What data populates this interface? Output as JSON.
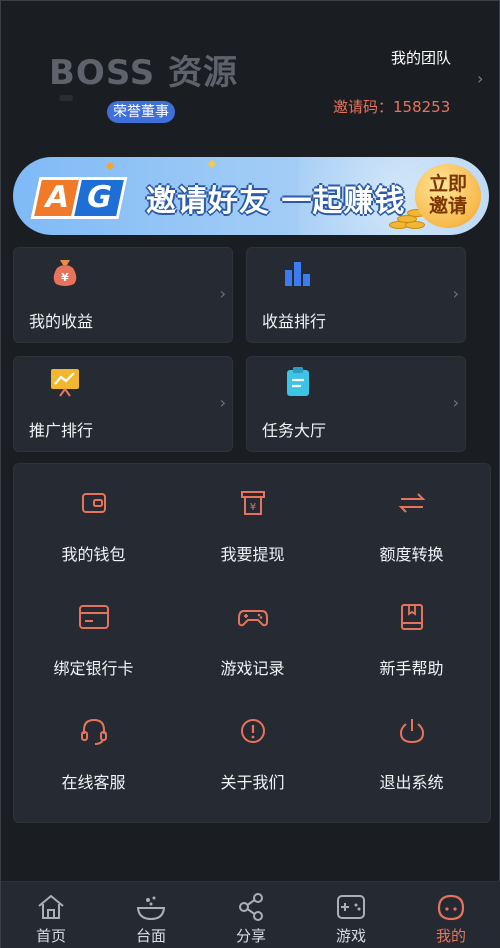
{
  "header": {
    "watermark": "BOSS 资源",
    "rank_badge": "荣誉董事",
    "team_link": "我的团队",
    "team_chevron": "›",
    "invite_code": "邀请码：158253"
  },
  "banner": {
    "logo_a": "A",
    "logo_g": "G",
    "title": "邀请好友 一起赚钱",
    "cta_line1": "立即",
    "cta_line2": "邀请"
  },
  "cards": [
    {
      "label": "我的收益",
      "icon": "money-bag-icon",
      "chevron": "›"
    },
    {
      "label": "收益排行",
      "icon": "bar-chart-icon",
      "chevron": "›"
    },
    {
      "label": "推广排行",
      "icon": "trend-board-icon",
      "chevron": "›"
    },
    {
      "label": "任务大厅",
      "icon": "clipboard-icon",
      "chevron": "›"
    }
  ],
  "grid": [
    {
      "label": "我的钱包",
      "icon": "wallet-icon"
    },
    {
      "label": "我要提现",
      "icon": "withdraw-icon"
    },
    {
      "label": "额度转换",
      "icon": "transfer-icon"
    },
    {
      "label": "绑定银行卡",
      "icon": "bank-card-icon"
    },
    {
      "label": "游戏记录",
      "icon": "gamepad-icon"
    },
    {
      "label": "新手帮助",
      "icon": "book-icon"
    },
    {
      "label": "在线客服",
      "icon": "headset-icon"
    },
    {
      "label": "关于我们",
      "icon": "info-icon"
    },
    {
      "label": "退出系统",
      "icon": "power-icon"
    }
  ],
  "nav": [
    {
      "label": "首页",
      "icon": "home-icon"
    },
    {
      "label": "台面",
      "icon": "table-icon"
    },
    {
      "label": "分享",
      "icon": "share-icon"
    },
    {
      "label": "游戏",
      "icon": "game-icon"
    },
    {
      "label": "我的",
      "icon": "profile-icon",
      "active": true
    }
  ],
  "colors": {
    "accent": "#e8735c",
    "background": "#1a1d22",
    "card": "#262b33",
    "badge": "#3f6fd8"
  }
}
